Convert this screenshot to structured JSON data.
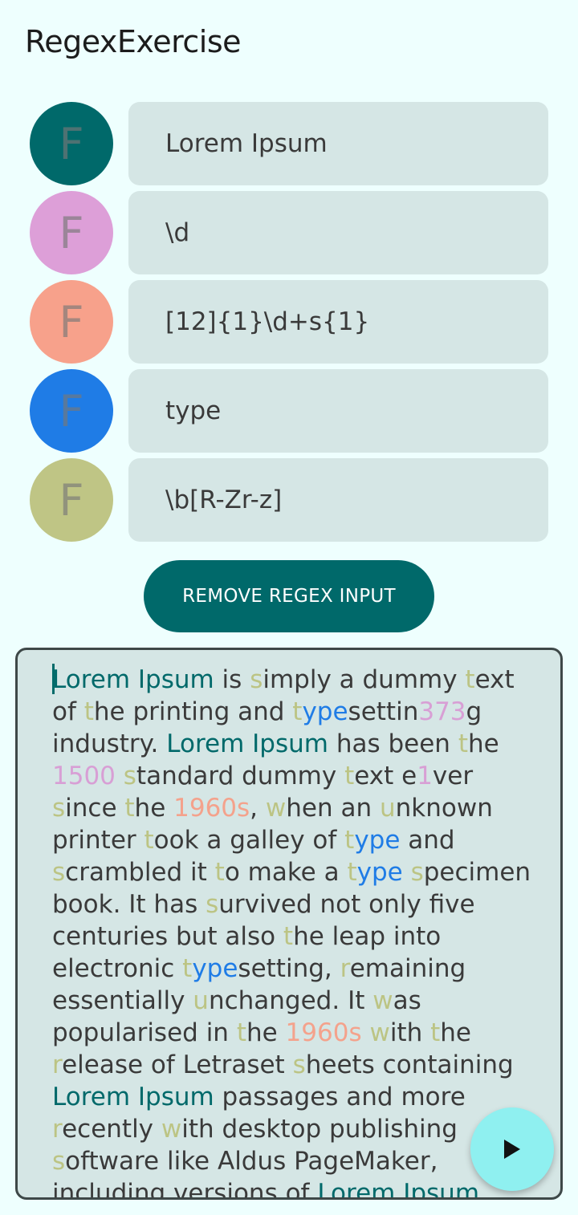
{
  "app": {
    "title": "RegexExercise"
  },
  "regex_inputs": [
    {
      "avatar_letter": "F",
      "color": "#00696a",
      "value": "Lorem Ipsum"
    },
    {
      "avatar_letter": "F",
      "color": "#dd9fd8",
      "value": "\\d"
    },
    {
      "avatar_letter": "F",
      "color": "#f7a18b",
      "value": "[12]{1}\\d+s{1}"
    },
    {
      "avatar_letter": "F",
      "color": "#1f7ce6",
      "value": "type"
    },
    {
      "avatar_letter": "F",
      "color": "#bfc585",
      "value": "\\b[R-Zr-z]"
    }
  ],
  "remove_button": {
    "label": "REMOVE REGEX INPUT"
  },
  "text_area": {
    "segments": [
      [
        "Lorem Ipsum",
        0
      ],
      [
        " is ",
        -1
      ],
      [
        "s",
        4
      ],
      [
        "imply a dummy ",
        -1
      ],
      [
        "t",
        4
      ],
      [
        "ext\nof ",
        -1
      ],
      [
        "t",
        4
      ],
      [
        "he printing and ",
        -1
      ],
      [
        "t",
        4
      ],
      [
        "ype",
        3
      ],
      [
        "settin",
        -1
      ],
      [
        "373",
        1
      ],
      [
        "g\nindustry. ",
        -1
      ],
      [
        "Lorem Ipsum",
        0
      ],
      [
        " has been ",
        -1
      ],
      [
        "t",
        4
      ],
      [
        "he\n",
        -1
      ],
      [
        "1500",
        1
      ],
      [
        " ",
        -1
      ],
      [
        "s",
        4
      ],
      [
        "tandard dummy ",
        -1
      ],
      [
        "t",
        4
      ],
      [
        "ext e",
        -1
      ],
      [
        "1",
        1
      ],
      [
        "ver\n",
        -1
      ],
      [
        "s",
        4
      ],
      [
        "ince ",
        -1
      ],
      [
        "t",
        4
      ],
      [
        "he ",
        -1
      ],
      [
        "1960s",
        2
      ],
      [
        ", ",
        -1
      ],
      [
        "w",
        4
      ],
      [
        "hen an ",
        -1
      ],
      [
        "u",
        4
      ],
      [
        "nknown\nprinter ",
        -1
      ],
      [
        "t",
        4
      ],
      [
        "ook a galley of ",
        -1
      ],
      [
        "t",
        4
      ],
      [
        "ype",
        3
      ],
      [
        " and\n",
        -1
      ],
      [
        "s",
        4
      ],
      [
        "crambled it ",
        -1
      ],
      [
        "t",
        4
      ],
      [
        "o make a ",
        -1
      ],
      [
        "t",
        4
      ],
      [
        "ype",
        3
      ],
      [
        " ",
        -1
      ],
      [
        "s",
        4
      ],
      [
        "pecimen\nbook. It has ",
        -1
      ],
      [
        "s",
        4
      ],
      [
        "urvived not only five\ncenturies but also ",
        -1
      ],
      [
        "t",
        4
      ],
      [
        "he leap into\nelectronic ",
        -1
      ],
      [
        "t",
        4
      ],
      [
        "ype",
        3
      ],
      [
        "setting, ",
        -1
      ],
      [
        "r",
        4
      ],
      [
        "emaining\nessentially ",
        -1
      ],
      [
        "u",
        4
      ],
      [
        "nchanged. It ",
        -1
      ],
      [
        "w",
        4
      ],
      [
        "as\npopularised in ",
        -1
      ],
      [
        "t",
        4
      ],
      [
        "he ",
        -1
      ],
      [
        "1960s",
        2
      ],
      [
        " ",
        -1
      ],
      [
        "w",
        4
      ],
      [
        "ith ",
        -1
      ],
      [
        "t",
        4
      ],
      [
        "he\n",
        -1
      ],
      [
        "r",
        4
      ],
      [
        "elease of Letraset ",
        -1
      ],
      [
        "s",
        4
      ],
      [
        "heets containing\n",
        -1
      ],
      [
        "Lorem Ipsum",
        0
      ],
      [
        " passages and more\n",
        -1
      ],
      [
        "r",
        4
      ],
      [
        "ecently ",
        -1
      ],
      [
        "w",
        4
      ],
      [
        "ith desktop publishing\n",
        -1
      ],
      [
        "s",
        4
      ],
      [
        "oftware like Aldus PageMaker,\nincluding versions of ",
        -1
      ],
      [
        "Lorem Ipsum",
        0
      ],
      [
        ".",
        -1
      ]
    ]
  },
  "run_button": {
    "icon": "play-icon"
  }
}
